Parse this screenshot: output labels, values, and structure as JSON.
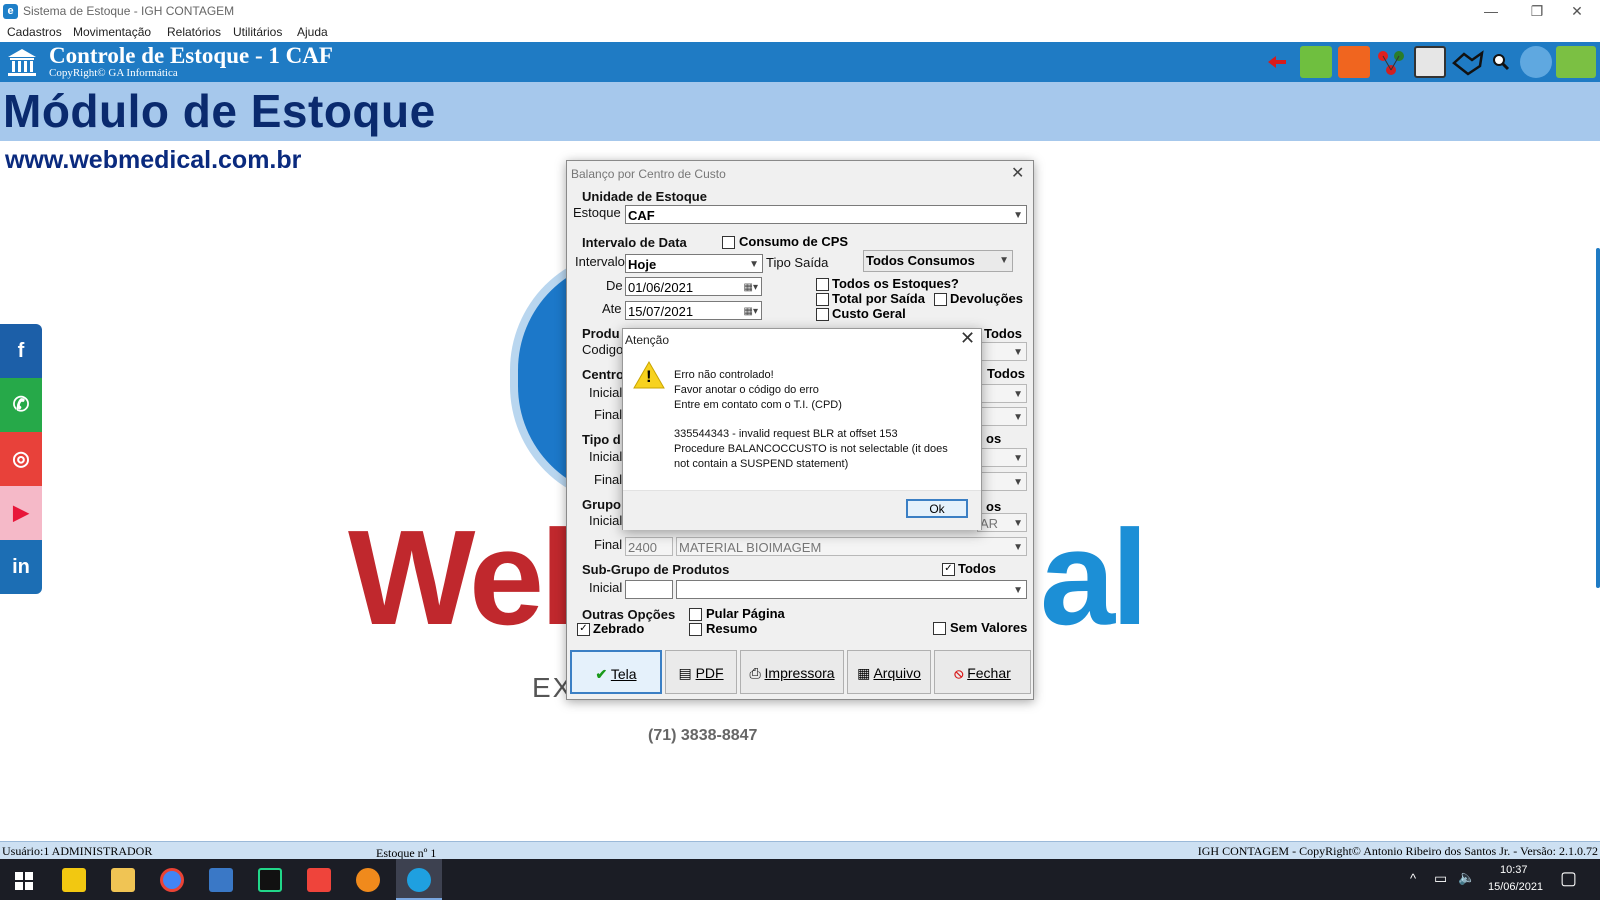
{
  "window": {
    "title": "Sistema de Estoque - IGH CONTAGEM",
    "minimize": "—",
    "restore": "❐",
    "close": "✕"
  },
  "menu": [
    "Cadastros",
    "Movimentação",
    "Relatórios",
    "Utilitários",
    "Ajuda"
  ],
  "header": {
    "title": "Controle de Estoque - 1 CAF",
    "copyright": "CopyRight© GA Informática",
    "toolbar_icons": [
      "back-arrow-icon",
      "shopping-cart-green-icon",
      "shopping-cart-orange-icon",
      "molecule-icon",
      "frame-icon",
      "handshake-icon",
      "magnifier-icon",
      "globe-icon",
      "sms-icon"
    ]
  },
  "banner": {
    "module": "Módulo de Estoque",
    "website": "www.webmedical.com.br"
  },
  "social": [
    "facebook-icon",
    "whatsapp-icon",
    "instagram-icon",
    "youtube-icon",
    "linkedin-icon"
  ],
  "social_glyphs": [
    "f",
    "✆",
    "◎",
    "▶",
    "in"
  ],
  "background_logo": {
    "left_text": "Wel",
    "right_text": "al",
    "tagline": "EX",
    "phone": "(71) 3838-8847"
  },
  "balance_dialog": {
    "title": "Balanço por Centro de Custo",
    "close": "✕",
    "unidade": {
      "heading": "Unidade de Estoque",
      "estoque_label": "Estoque",
      "estoque_value": "CAF"
    },
    "intervalo": {
      "heading": "Intervalo de Data",
      "consumo_cps": "Consumo de CPS",
      "intervalo_label": "Intervalo",
      "intervalo_value": "Hoje",
      "tipo_saida_label": "Tipo Saída",
      "tipo_saida_value": "Todos Consumos",
      "de_label": "De",
      "de_value": "01/06/2021",
      "ate_label": "Ate",
      "ate_value": "15/07/2021",
      "todos_estoques": "Todos os Estoques?",
      "total_por_saida": "Total por Saída",
      "devolucoes": "Devoluções",
      "custo_geral": "Custo Geral"
    },
    "produto": {
      "heading": "Produ",
      "codigo_label": "Codigo",
      "todos": "Todos"
    },
    "centro": {
      "heading": "Centro",
      "inicial_label": "Inicial",
      "final_label": "Final",
      "todos": "Todos"
    },
    "tipo": {
      "heading": "Tipo d",
      "inicial_label": "Inicial",
      "final_label": "Final",
      "todos_partial": "os"
    },
    "grupo": {
      "heading": "Grupo",
      "inicial_label": "Inicial",
      "inicial_desc_partial": "AR",
      "final_label": "Final",
      "final_code": "2400",
      "final_desc": "MATERIAL BIOIMAGEM",
      "todos_partial": "os"
    },
    "subgrupo": {
      "heading": "Sub-Grupo de Produtos",
      "todos": "Todos",
      "inicial_label": "Inicial"
    },
    "outras": {
      "heading": "Outras Opções",
      "pular_pagina": "Pular Página",
      "zebrado": "Zebrado",
      "resumo": "Resumo",
      "sem_valores": "Sem Valores"
    },
    "buttons": {
      "tela": "Tela",
      "pdf": "PDF",
      "impressora": "Impressora",
      "arquivo": "Arquivo",
      "fechar": "Fechar"
    },
    "button_glyphs": {
      "tela": "✔",
      "pdf": "▤",
      "impressora": "⎙",
      "arquivo": "▦",
      "fechar": "⦸"
    }
  },
  "alert": {
    "title": "Atenção",
    "close": "✕",
    "icon": "warning-icon",
    "icon_glyph": "!",
    "lines": [
      "Erro não controlado!",
      "Favor anotar o código do erro",
      "Entre em contato com o T.I. (CPD)",
      "335544343 - invalid request BLR at offset 153",
      "Procedure BALANCOCCUSTO is not selectable (it does",
      "not contain a SUSPEND statement)"
    ],
    "ok": "Ok"
  },
  "statusbar": {
    "user": "Usuário:1 ADMINISTRADOR",
    "estoque": "Estoque nº 1",
    "right": "IGH CONTAGEM - CopyRight© Antonio Ribeiro dos Santos Jr. - Versão: 2.1.0.72"
  },
  "taskbar": {
    "apps": [
      "windows-start-icon",
      "powerbi-icon",
      "file-explorer-icon",
      "chrome-icon",
      "remote-desktop-icon",
      "pycharm-icon",
      "anydesk-icon",
      "app-c-icon",
      "estoque-app-icon"
    ],
    "time": "10:37",
    "date": "15/06/2021",
    "tray": [
      "chevron-up-icon",
      "network-icon",
      "volume-icon"
    ],
    "tray_glyphs": [
      "^",
      "▭",
      "🔈"
    ],
    "notification_glyph": "▢"
  },
  "colors": {
    "header": "#1f7bc4",
    "banner": "#a6c8ec",
    "logo_red": "#c0282d",
    "logo_blue": "#1c8fd6"
  }
}
